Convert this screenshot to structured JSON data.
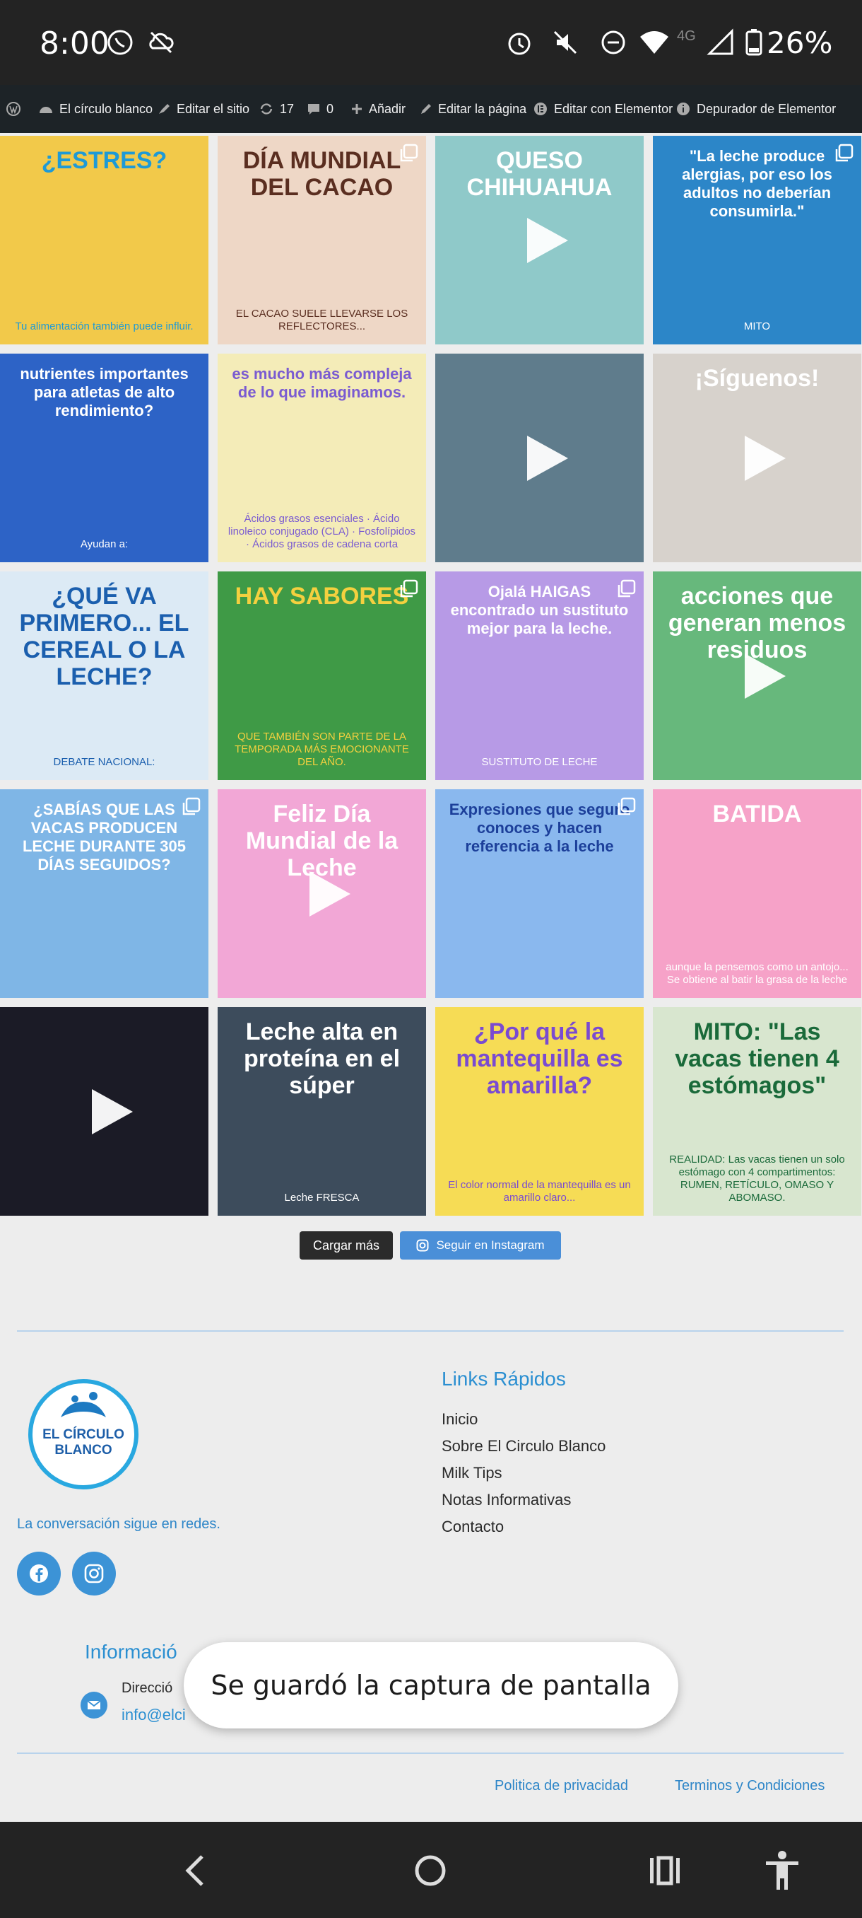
{
  "status_bar": {
    "time": "8:00",
    "battery": "26%",
    "network": "4G",
    "icons": [
      "whatsapp-icon",
      "cloud-off-icon",
      "alarm-icon",
      "mute-icon",
      "dnd-icon",
      "wifi-icon",
      "signal-icon",
      "battery-icon"
    ]
  },
  "admin_bar": {
    "site_name": "El círculo blanco",
    "customize": "Editar el sitio",
    "updates": "17",
    "comments": "0",
    "new": "Añadir",
    "edit_page": "Editar la página",
    "elementor": "Editar con Elementor",
    "debugger": "Depurador de Elementor"
  },
  "feed": {
    "posts": [
      {
        "caption": "¿ESTRES?",
        "sub": "Tu alimentación también puede influir.",
        "bg": "#f2c94a",
        "text_color": "#1e9ad6",
        "video": false,
        "multi": false
      },
      {
        "caption": "DÍA MUNDIAL DEL CACAO",
        "sub": "EL CACAO SUELE LLEVARSE LOS REFLECTORES...",
        "bg": "#eed7c6",
        "text_color": "#5a2e20",
        "video": false,
        "multi": true
      },
      {
        "caption": "QUESO CHIHUAHUA",
        "sub": "",
        "bg": "#8fc9c9",
        "text_color": "#ffffff",
        "video": true,
        "multi": false
      },
      {
        "caption": "\"La leche produce alergias, por eso los adultos no deberían consumirla.\"",
        "sub": "MITO",
        "bg": "#2c86c8",
        "text_color": "#ffffff",
        "video": false,
        "multi": true
      },
      {
        "caption": "nutrientes importantes para atletas de alto rendimiento?",
        "sub": "Ayudan a:",
        "bg": "#2d63c6",
        "text_color": "#ffffff",
        "video": false,
        "multi": false
      },
      {
        "caption": "es mucho más compleja de lo que imaginamos.",
        "sub": "Ácidos grasos esenciales · Ácido linoleico conjugado (CLA) · Fosfolípidos · Ácidos grasos de cadena corta",
        "bg": "#f4ecb8",
        "text_color": "#7a5bd1",
        "video": false,
        "multi": false
      },
      {
        "caption": "",
        "sub": "",
        "bg": "#5f7c8c",
        "text_color": "#ffffff",
        "video": true,
        "multi": false
      },
      {
        "caption": "¡Síguenos!",
        "sub": "",
        "bg": "#d7d2cc",
        "text_color": "#ffffff",
        "video": true,
        "multi": false
      },
      {
        "caption": "¿QUÉ VA PRIMERO... EL CEREAL O LA LECHE?",
        "sub": "DEBATE NACIONAL:",
        "bg": "#dceaf5",
        "text_color": "#1b5fae",
        "video": false,
        "multi": false
      },
      {
        "caption": "HAY SABORES",
        "sub": "QUE TAMBIÉN SON PARTE DE LA TEMPORADA MÁS EMOCIONANTE DEL AÑO.",
        "bg": "#3f9a46",
        "text_color": "#f4d03f",
        "video": false,
        "multi": true
      },
      {
        "caption": "Ojalá HAIGAS encontrado un sustituto mejor para la leche.",
        "sub": "SUSTITUTO DE LECHE",
        "bg": "#b79ae6",
        "text_color": "#ffffff",
        "video": false,
        "multi": true
      },
      {
        "caption": "acciones que generan menos residuos",
        "sub": "",
        "bg": "#67b87c",
        "text_color": "#ffffff",
        "video": true,
        "multi": false
      },
      {
        "caption": "¿SABÍAS QUE LAS VACAS PRODUCEN LECHE DURANTE 305 DÍAS SEGUIDOS?",
        "sub": "",
        "bg": "#7fb6e6",
        "text_color": "#ffffff",
        "video": false,
        "multi": true
      },
      {
        "caption": "Feliz Día Mundial de la Leche",
        "sub": "",
        "bg": "#f2a7d6",
        "text_color": "#ffffff",
        "video": true,
        "multi": false
      },
      {
        "caption": "Expresiones que seguro conoces y hacen referencia a la leche",
        "sub": "",
        "bg": "#8ab8ee",
        "text_color": "#1c3f9a",
        "video": false,
        "multi": true
      },
      {
        "caption": "BATIDA",
        "sub": "aunque la pensemos como un antojo... Se obtiene al batir la grasa de la leche",
        "bg": "#f6a2c8",
        "text_color": "#ffffff",
        "video": false,
        "multi": false
      },
      {
        "caption": "",
        "sub": "",
        "bg": "#1b1b26",
        "text_color": "#ffffff",
        "video": true,
        "multi": false
      },
      {
        "caption": "Leche alta en proteína en el súper",
        "sub": "Leche FRESCA",
        "bg": "#3d4c5c",
        "text_color": "#ffffff",
        "video": false,
        "multi": false
      },
      {
        "caption": "¿Por qué la mantequilla es amarilla?",
        "sub": "El color normal de la mantequilla es un amarillo claro...",
        "bg": "#f6dc55",
        "text_color": "#7a4bd1",
        "video": false,
        "multi": false
      },
      {
        "caption": "MITO: \"Las vacas tienen 4 estómagos\"",
        "sub": "REALIDAD: Las vacas tienen un solo estómago con 4 compartimentos: RUMEN, RETÍCULO, OMASO Y ABOMASO.",
        "bg": "#d8e6cf",
        "text_color": "#1a6a3a",
        "video": false,
        "multi": false
      }
    ],
    "load_more": "Cargar más",
    "follow": "Seguir en Instagram"
  },
  "footer": {
    "logo_text": "EL CÍRCULO BLANCO",
    "tagline": "La conversación sigue en redes.",
    "links_title": "Links Rápidos",
    "links": [
      "Inicio",
      "Sobre El Circulo Blanco",
      "Milk Tips",
      "Notas Informativas",
      "Contacto"
    ],
    "info_title": "Informació",
    "address_label": "Direcció",
    "email": "info@elci",
    "privacy": "Politica de privacidad",
    "terms": "Terminos y Condiciones"
  },
  "toast": "Se guardó la captura de pantalla",
  "colors": {
    "accent": "#2b8fd1",
    "admin_bar": "#1d2327",
    "system_bar": "#232323"
  }
}
